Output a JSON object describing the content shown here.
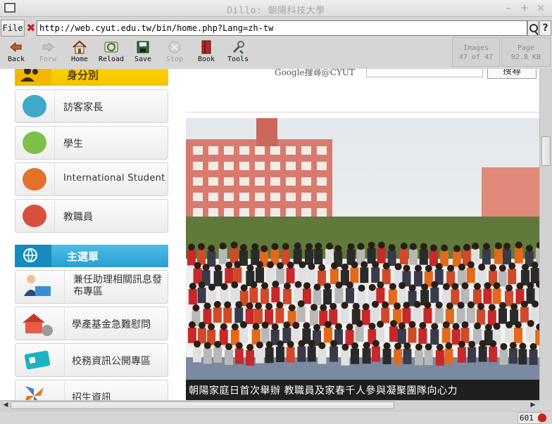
{
  "window": {
    "title": "Dillo: 朝陽科技大學",
    "controls": [
      "–",
      "+",
      "×"
    ]
  },
  "urlbar": {
    "file_label": "File",
    "clear_glyph": "✖",
    "url": "http://web.cyut.edu.tw/bin/home.php?Lang=zh-tw",
    "help_glyph": "?"
  },
  "toolbar": {
    "buttons": [
      {
        "label": "Back",
        "icon": "back-arrow-icon",
        "enabled": true
      },
      {
        "label": "Forw",
        "icon": "forward-arrow-icon",
        "enabled": false
      },
      {
        "label": "Home",
        "icon": "home-icon",
        "enabled": true
      },
      {
        "label": "Reload",
        "icon": "reload-icon",
        "enabled": true
      },
      {
        "label": "Save",
        "icon": "save-icon",
        "enabled": true
      },
      {
        "label": "Stop",
        "icon": "stop-icon",
        "enabled": false
      },
      {
        "label": "Book",
        "icon": "bookmarks-icon",
        "enabled": true
      },
      {
        "label": "Tools",
        "icon": "tools-icon",
        "enabled": true
      }
    ],
    "images_meter": {
      "title": "Images",
      "value": "47 of 47"
    },
    "page_meter": {
      "title": "Page",
      "value": "92.8 KB"
    }
  },
  "page": {
    "identity_header": "身分別",
    "identity_items": [
      {
        "label": "訪客家長",
        "icon": "visitor-icon",
        "color": "#3ea9c8"
      },
      {
        "label": "學生",
        "icon": "student-icon",
        "color": "#7cbf4a"
      },
      {
        "label": "International Student",
        "icon": "globe-user-icon",
        "color": "#e2712a"
      },
      {
        "label": "教職員",
        "icon": "staff-icon",
        "color": "#d94f3d"
      }
    ],
    "main_header": "主選單",
    "main_items": [
      {
        "label": "兼任助理相關訊息發布專區",
        "icon": "assistant-icon"
      },
      {
        "label": "學產基金急難慰問",
        "icon": "fund-house-icon"
      },
      {
        "label": "校務資訊公開專區",
        "icon": "info-card-icon"
      },
      {
        "label": "招生資訊",
        "icon": "pinwheel-icon"
      }
    ],
    "google_label": "Google搜尋@CYUT",
    "google_button": "搜尋",
    "caption": "朝陽家庭日首次舉辦  教職員及家春千人參與凝聚團隊向心力"
  },
  "status": {
    "count": "601"
  }
}
